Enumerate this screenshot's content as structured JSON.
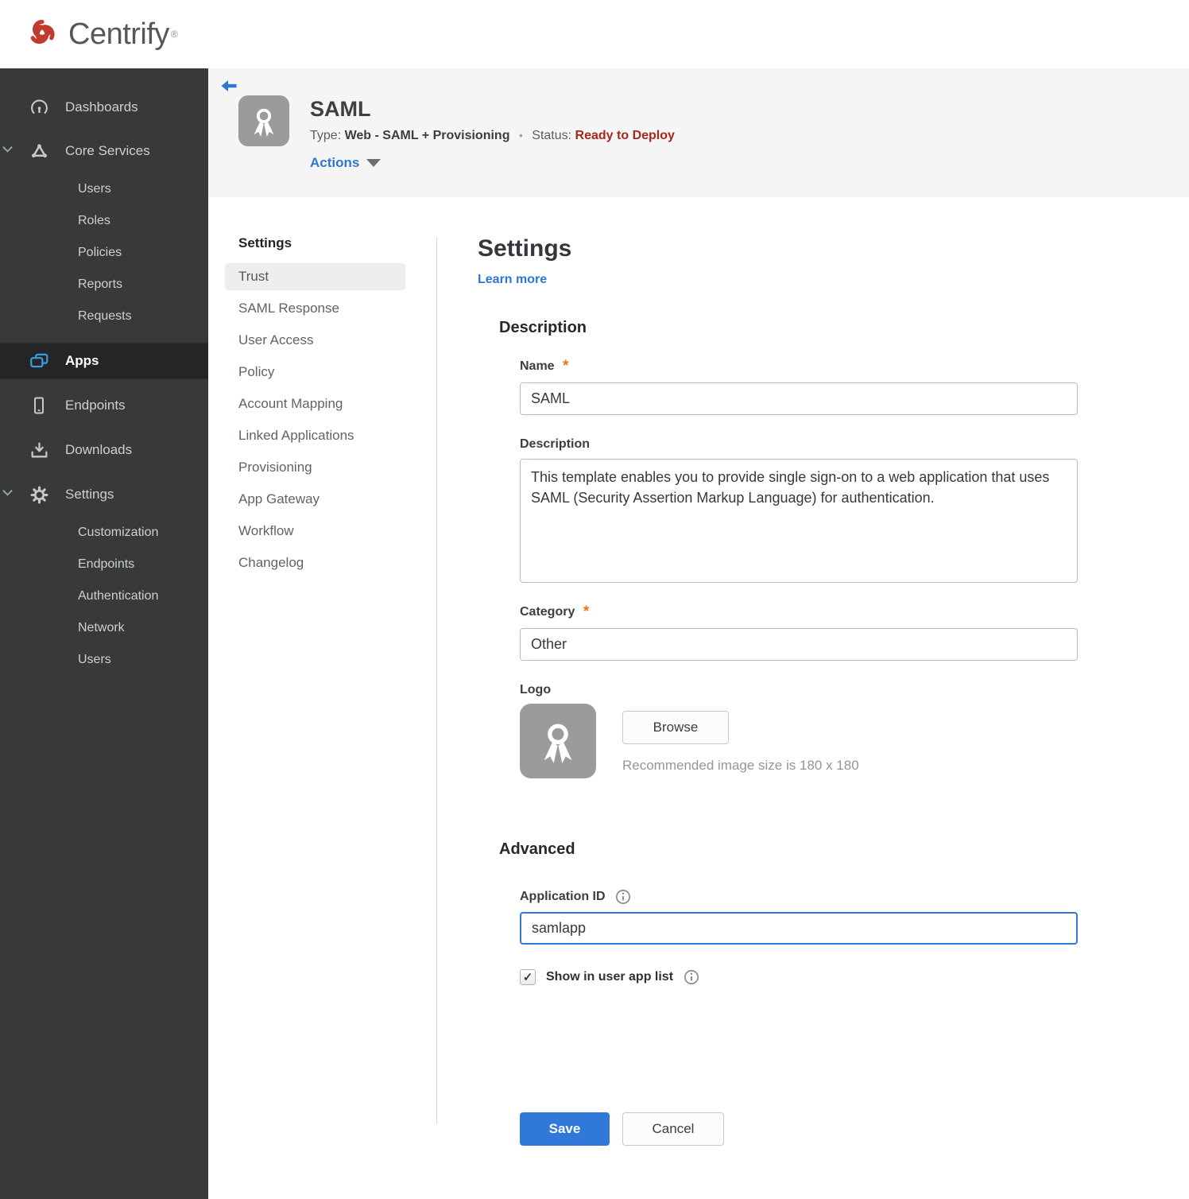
{
  "brand": {
    "name": "Centrify",
    "registered_mark": "®",
    "logo_color": "#c03b2d"
  },
  "sidebar": {
    "items": [
      {
        "label": "Dashboards",
        "icon": "dashboard-icon"
      },
      {
        "label": "Core Services",
        "icon": "core-services-icon",
        "expanded": true,
        "children": [
          "Users",
          "Roles",
          "Policies",
          "Reports",
          "Requests"
        ]
      },
      {
        "label": "Apps",
        "icon": "apps-icon",
        "active": true
      },
      {
        "label": "Endpoints",
        "icon": "endpoints-icon"
      },
      {
        "label": "Downloads",
        "icon": "downloads-icon"
      },
      {
        "label": "Settings",
        "icon": "settings-icon",
        "expanded": true,
        "children": [
          "Customization",
          "Endpoints",
          "Authentication",
          "Network",
          "Users"
        ]
      }
    ]
  },
  "header": {
    "app_name": "SAML",
    "type_label": "Type:",
    "type_value": "Web - SAML + Provisioning",
    "separator": "•",
    "status_label": "Status:",
    "status_value": "Ready to Deploy",
    "actions_label": "Actions"
  },
  "subnav": {
    "title": "Settings",
    "active_item": "Trust",
    "items": [
      "Trust",
      "SAML Response",
      "User Access",
      "Policy",
      "Account Mapping",
      "Linked Applications",
      "Provisioning",
      "App Gateway",
      "Workflow",
      "Changelog"
    ]
  },
  "main": {
    "title": "Settings",
    "learn_more": "Learn more",
    "description_section": {
      "heading": "Description",
      "name_label": "Name",
      "name_required": "*",
      "name_value": "SAML",
      "description_label": "Description",
      "description_value": "This template enables you to provide single sign-on to a web application that uses SAML (Security Assertion Markup Language) for authentication.",
      "category_label": "Category",
      "category_required": "*",
      "category_value": "Other",
      "logo_label": "Logo",
      "browse_button": "Browse",
      "logo_hint": "Recommended image size is 180 x 180"
    },
    "advanced_section": {
      "heading": "Advanced",
      "application_id_label": "Application ID",
      "application_id_value": "samlapp",
      "show_in_user_app_list_label": "Show in user app list",
      "checkbox_checked": true
    },
    "save_button": "Save",
    "cancel_button": "Cancel"
  },
  "colors": {
    "accent_blue": "#2e77d0",
    "status_red": "#a6281b",
    "asterisk_orange": "#e87722",
    "apps_icon_blue": "#3aa0dd",
    "sidebar_bg": "#37393b",
    "header_bg": "#f5f5f6"
  }
}
